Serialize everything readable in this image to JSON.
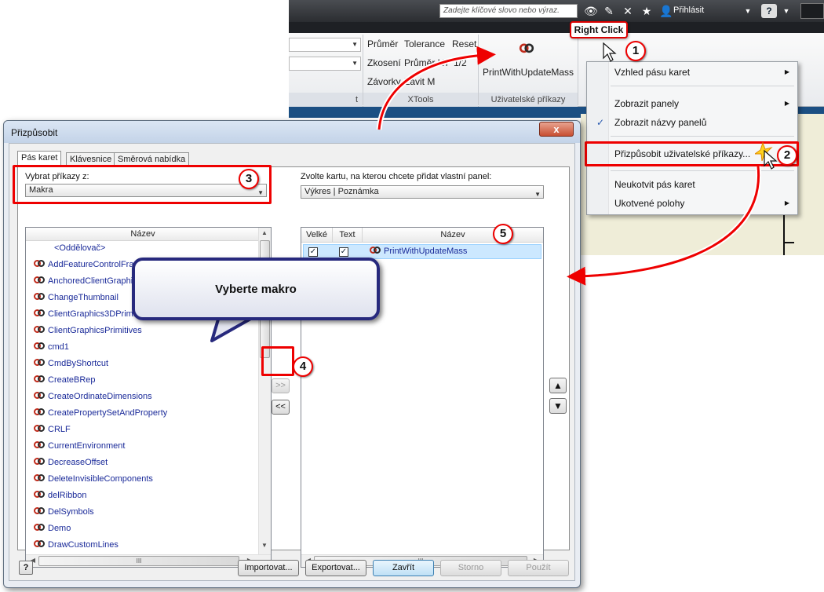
{
  "background_app": {
    "search_placeholder": "Zadejte klíčové slovo nebo výraz.",
    "login_label": "Přihlásit",
    "help_label": "?",
    "ribbon": {
      "xtools_row1": [
        "Průměr",
        "Tolerance",
        "Reset"
      ],
      "xtools_row2": [
        "Zkosení",
        "Průměr H7",
        "1/2"
      ],
      "xtools_row3": [
        "Závorky",
        "Závit M"
      ],
      "xtools_panel_title": "XTools",
      "macro_button_label": "PrintWithUpdateMass",
      "user_panel_title": "Uživatelské příkazy",
      "left_panel_title_fragment": "t"
    }
  },
  "annotations": {
    "right_click": "Right Click",
    "badges": [
      "1",
      "2",
      "3",
      "4",
      "5"
    ],
    "callout": "Vyberte makro"
  },
  "context_menu": {
    "items": [
      {
        "label": "Vzhled pásu karet",
        "submenu": true,
        "checked": false
      },
      {
        "label": "Zobrazit panely",
        "submenu": true,
        "checked": false
      },
      {
        "label": "Zobrazit názvy panelů",
        "submenu": false,
        "checked": true
      },
      {
        "label": "Přizpůsobit uživatelské příkazy...",
        "submenu": false,
        "checked": false
      },
      {
        "label": "Neukotvit pás karet",
        "submenu": false,
        "checked": false
      },
      {
        "label": "Ukotvené polohy",
        "submenu": true,
        "checked": false
      }
    ],
    "check_mark": "✓"
  },
  "dialog": {
    "title": "Přizpůsobit",
    "close_label": "x",
    "tabs": [
      "Pás karet",
      "Klávesnice",
      "Směrová nabídka"
    ],
    "left": {
      "label": "Vybrat příkazy z:",
      "combo_value": "Makra",
      "column_header": "Název",
      "items": [
        "<Oddělovač>",
        "AddFeatureControlFrame",
        "AnchoredClientGraphics",
        "ChangeThumbnail",
        "ClientGraphics3DPrimitiv",
        "ClientGraphicsPrimitives",
        "cmd1",
        "CmdByShortcut",
        "CreateBRep",
        "CreateOrdinateDimensions",
        "CreatePropertySetAndProperty",
        "CRLF",
        "CurrentEnvironment",
        "DecreaseOffset",
        "DeleteInvisibleComponents",
        "delRibbon",
        "DelSymbols",
        "Demo",
        "DrawCustomLines"
      ],
      "hscroll_grip": "III"
    },
    "right": {
      "label": "Zvolte kartu, na kterou chcete přidat vlastní panel:",
      "combo_value": "Výkres | Poznámka",
      "col_large": "Velké",
      "col_text": "Text",
      "col_name": "Název",
      "row": {
        "large": true,
        "text": true,
        "name": "PrintWithUpdateMass"
      },
      "hscroll_grip": "III"
    },
    "move_add": ">>",
    "move_remove": "<<",
    "up_arrow": "▲",
    "down_arrow": "▼",
    "buttons": {
      "help": "?",
      "import": "Importovat...",
      "export": "Exportovat...",
      "close": "Zavřít",
      "cancel": "Storno",
      "apply": "Použít"
    }
  },
  "colors": {
    "annotation_red": "#e00000",
    "callout_border": "#27297d",
    "selection_blue": "#cce8ff",
    "ribbon_blue": "#1b4f83"
  }
}
